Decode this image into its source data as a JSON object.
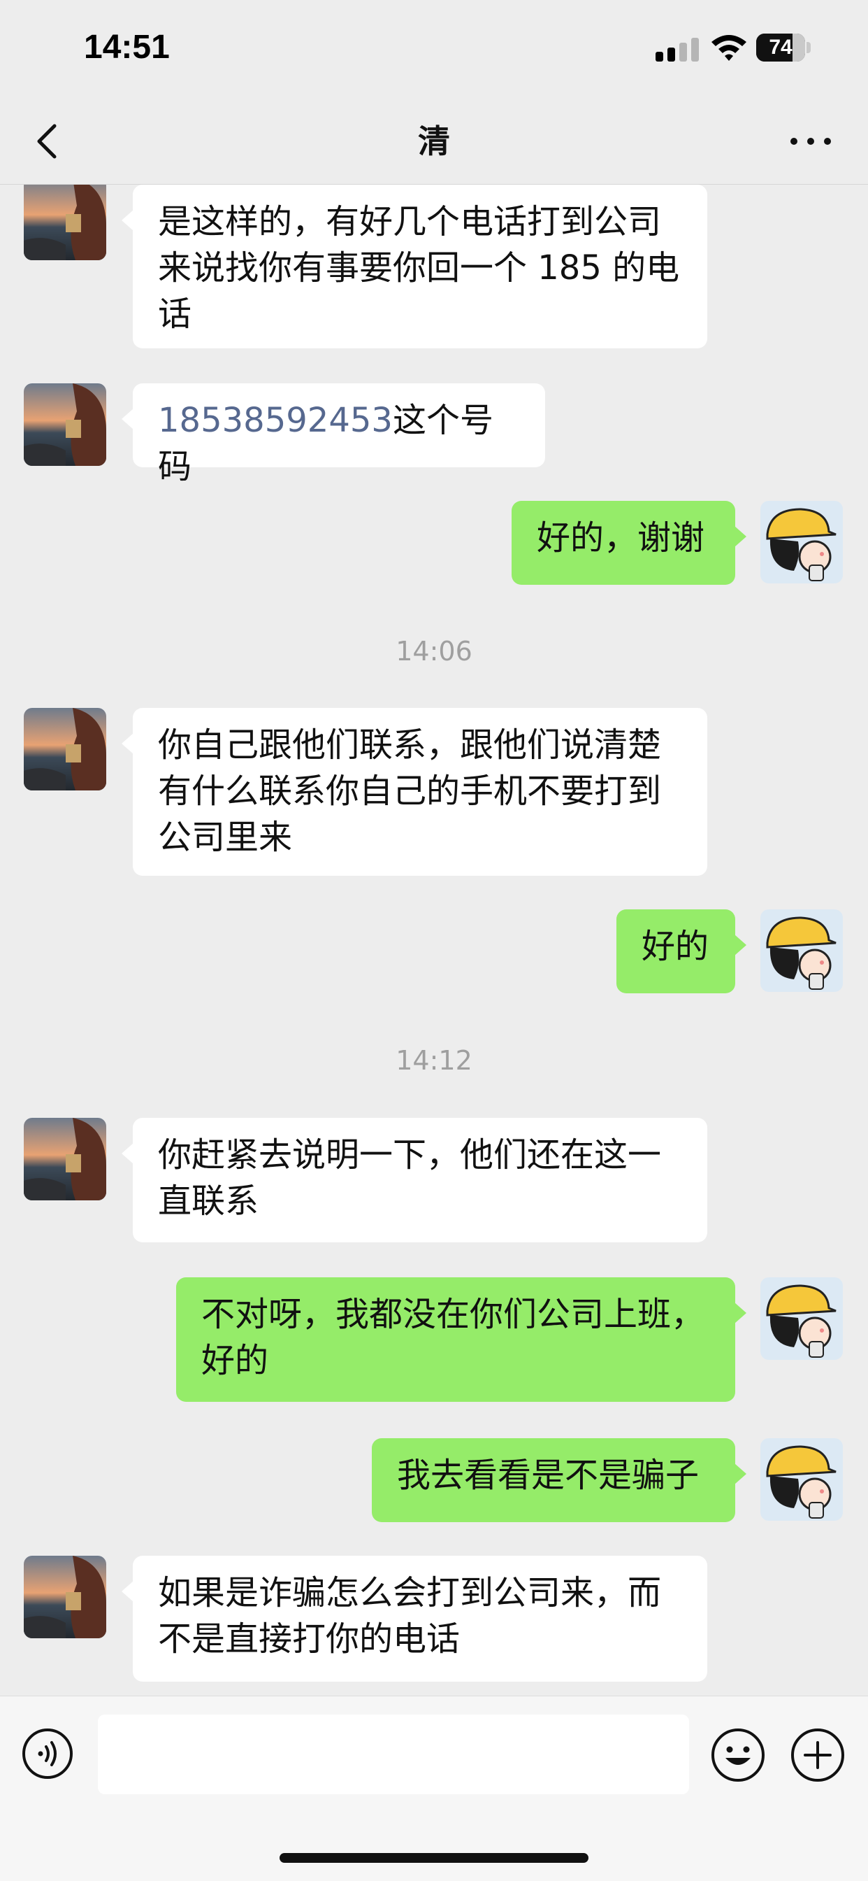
{
  "status_bar": {
    "time": "14:51",
    "battery": "74",
    "battery_level": 0.74
  },
  "header": {
    "title": "清"
  },
  "messages": [
    {
      "text": "是这样的，有好几个电话打到公司来说找你有事要你回一个 185 的电话"
    },
    {
      "link": "18538592453",
      "suffix": "这个号码"
    },
    {
      "text": "好的，谢谢"
    },
    {
      "timestamp": "14:06"
    },
    {
      "text": "你自己跟他们联系，跟他们说清楚有什么联系你自己的手机不要打到公司里来"
    },
    {
      "text": "好的"
    },
    {
      "timestamp": "14:12"
    },
    {
      "text": "你赶紧去说明一下，他们还在这一直联系"
    },
    {
      "text": "不对呀，我都没在你们公司上班，好的"
    },
    {
      "text": "我去看看是不是骗子"
    },
    {
      "text": "如果是诈骗怎么会打到公司来，而不是直接打你的电话"
    }
  ],
  "icons": {
    "back": "chevron-left-icon",
    "more": "more-dots-icon",
    "voice": "voice-input-icon",
    "emoji": "emoji-icon",
    "plus": "plus-icon"
  },
  "colors": {
    "sent_bubble": "#95ec69",
    "received_bubble": "#ffffff",
    "link": "#56688f",
    "background": "#ededed"
  }
}
